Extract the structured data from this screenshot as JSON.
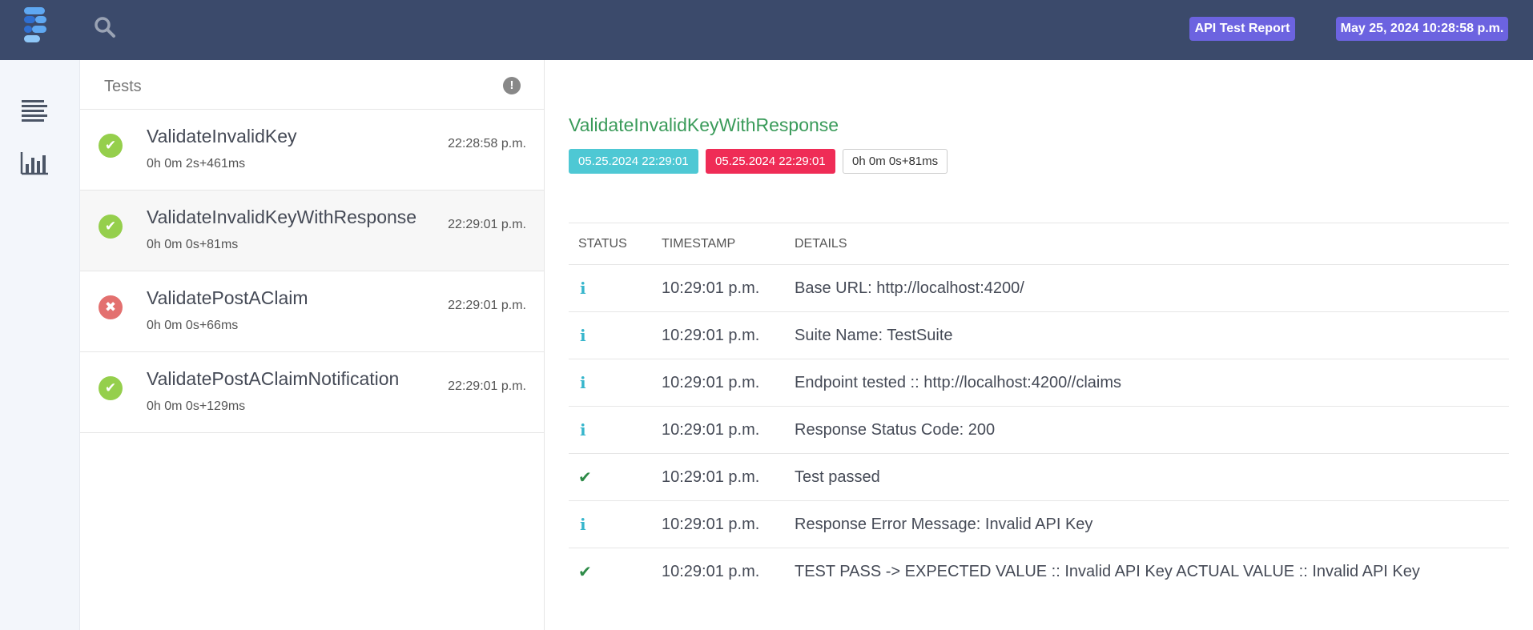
{
  "header": {
    "report_badge": "API Test Report",
    "date_badge": "May 25, 2024 10:28:58 p.m.",
    "logo_icon": "extent-logo-icon",
    "search_icon": "search-icon"
  },
  "leftnav": {
    "items": [
      {
        "icon": "list-icon",
        "name": "test-view"
      },
      {
        "icon": "bar-chart-icon",
        "name": "dashboard-view"
      }
    ]
  },
  "testlist": {
    "title": "Tests",
    "alert_glyph": "!",
    "tests": [
      {
        "name": "ValidateInvalidKey",
        "duration": "0h 0m 2s+461ms",
        "time": "22:28:58 p.m.",
        "status": "pass",
        "status_glyph": "✔"
      },
      {
        "name": "ValidateInvalidKeyWithResponse",
        "duration": "0h 0m 0s+81ms",
        "time": "22:29:01 p.m.",
        "status": "pass",
        "status_glyph": "✔"
      },
      {
        "name": "ValidatePostAClaim",
        "duration": "0h 0m 0s+66ms",
        "time": "22:29:01 p.m.",
        "status": "fail",
        "status_glyph": "✖"
      },
      {
        "name": "ValidatePostAClaimNotification",
        "duration": "0h 0m 0s+129ms",
        "time": "22:29:01 p.m.",
        "status": "pass",
        "status_glyph": "✔"
      }
    ]
  },
  "detail": {
    "title": "ValidateInvalidKeyWithResponse",
    "start": "05.25.2024 22:29:01",
    "end": "05.25.2024 22:29:01",
    "duration": "0h 0m 0s+81ms",
    "columns": [
      "STATUS",
      "TIMESTAMP",
      "DETAILS"
    ],
    "logs": [
      {
        "status": "info",
        "glyph": "i",
        "timestamp": "10:29:01 p.m.",
        "details": "Base URL: http://localhost:4200/"
      },
      {
        "status": "info",
        "glyph": "i",
        "timestamp": "10:29:01 p.m.",
        "details": "Suite Name: TestSuite"
      },
      {
        "status": "info",
        "glyph": "i",
        "timestamp": "10:29:01 p.m.",
        "details": "Endpoint tested :: http://localhost:4200//claims"
      },
      {
        "status": "info",
        "glyph": "i",
        "timestamp": "10:29:01 p.m.",
        "details": "Response Status Code: 200"
      },
      {
        "status": "pass",
        "glyph": "✔",
        "timestamp": "10:29:01 p.m.",
        "details": "Test passed"
      },
      {
        "status": "info",
        "glyph": "i",
        "timestamp": "10:29:01 p.m.",
        "details": "Response Error Message: Invalid API Key"
      },
      {
        "status": "pass",
        "glyph": "✔",
        "timestamp": "10:29:01 p.m.",
        "details": "TEST PASS -> EXPECTED VALUE :: Invalid API Key ACTUAL VALUE :: Invalid API Key"
      }
    ]
  },
  "colors": {
    "topbar": "#3b4a6b",
    "badge": "#6c63e0",
    "pass": "#95cf4c",
    "fail": "#e3706f",
    "title_green": "#3a9b5a",
    "start_pill": "#4ec8d4",
    "end_pill": "#ef2c56",
    "info_icon": "#38b6cc",
    "check_icon": "#2e8b48"
  }
}
